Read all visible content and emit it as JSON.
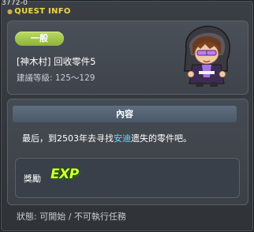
{
  "quest_id": "3772-0",
  "header": {
    "title": "QUEST INFO"
  },
  "quest": {
    "category": "一般",
    "name": "[神木村] 回收零件5",
    "recommended_level": "建議等級: 125～129"
  },
  "content": {
    "section_title": "內容",
    "description_before": "最后，到2503年去寻找",
    "description_highlight": "安迪",
    "description_after": "遗失的零件吧。"
  },
  "reward": {
    "label": "獎勵",
    "icon_text": "EXP"
  },
  "status": "狀態: 可開始 / 不可執行任務",
  "colors": {
    "title": "#f2d44a",
    "badge": "#a6c94e",
    "highlight": "#58e0ff",
    "exp": "#d6ff3a"
  }
}
